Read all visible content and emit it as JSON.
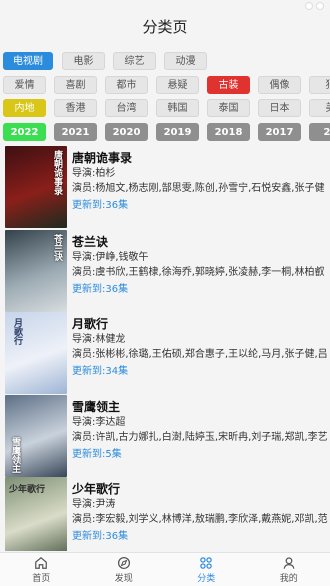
{
  "page_title": "分类页",
  "filters": {
    "genre": {
      "items": [
        "电视剧",
        "电影",
        "综艺",
        "动漫"
      ],
      "selected": "电视剧"
    },
    "type": {
      "items": [
        "爱情",
        "喜剧",
        "都市",
        "悬疑",
        "古装",
        "偶像",
        "犯"
      ],
      "selected": "古装"
    },
    "region": {
      "items": [
        "内地",
        "香港",
        "台湾",
        "韩国",
        "泰国",
        "日本",
        "美"
      ],
      "selected": "内地"
    },
    "year": {
      "items": [
        "2022",
        "2021",
        "2020",
        "2019",
        "2018",
        "2017",
        "20"
      ],
      "selected": "2022"
    }
  },
  "items": [
    {
      "title": "唐朝诡事录",
      "director": "导演:柏杉",
      "cast": "演员:杨旭文,杨志刚,郜思雯,陈创,孙雪宁,石悦安鑫,张子健",
      "update": "更新到:36集",
      "poster_text": "唐朝诡事录",
      "poster_colors": [
        "#3d0f12",
        "#8a1f1a",
        "#1d2a1f"
      ]
    },
    {
      "title": "苍兰诀",
      "director": "导演:伊峥,钱敬午",
      "cast": "演员:虞书欣,王鹤棣,徐海乔,郭晓婷,张凌赫,李一桐,林柏叡",
      "update": "更新到:36集",
      "poster_text": "苍兰诀",
      "poster_colors": [
        "#33414a",
        "#9aa9b1",
        "#d8dde0"
      ]
    },
    {
      "title": "月歌行",
      "director": "导演:林健龙",
      "cast": "演员:张彬彬,徐璐,王佑硕,郑合惠子,王以纶,马月,张子健,吕",
      "update": "更新到:34集",
      "poster_text": "月歌行",
      "poster_colors": [
        "#c6d4ea",
        "#eef1f8",
        "#9eb4d4"
      ]
    },
    {
      "title": "雪鹰领主",
      "director": "导演:李达超",
      "cast": "演员:许凯,古力娜扎,白澍,陆婷玉,宋昕冉,刘子瑞,郑凯,李艺",
      "update": "更新到:5集",
      "poster_text": "雪鹰领主",
      "poster_colors": [
        "#5d6f86",
        "#c9d2dc",
        "#384558"
      ]
    },
    {
      "title": "少年歌行",
      "director": "导演:尹涛",
      "cast": "演员:李宏毅,刘学义,林博洋,敖瑞鹏,李欣泽,戴燕妮,邓凯,范",
      "update": "更新到:36集",
      "poster_text": "少年歌行",
      "poster_colors": [
        "#7e8f74",
        "#d9dcc8",
        "#495a45"
      ]
    }
  ],
  "tabbar": [
    {
      "label": "首页",
      "icon": "home-icon"
    },
    {
      "label": "发现",
      "icon": "compass-icon"
    },
    {
      "label": "分类",
      "icon": "grid-icon"
    },
    {
      "label": "我的",
      "icon": "user-icon"
    }
  ],
  "active_tab": "分类",
  "colors": {
    "accent_blue": "#2b8bdd",
    "selected_red": "#e0322e",
    "selected_yellow": "#d8c619",
    "selected_green": "#3bdd51",
    "year_gray": "#8f8f8f"
  }
}
